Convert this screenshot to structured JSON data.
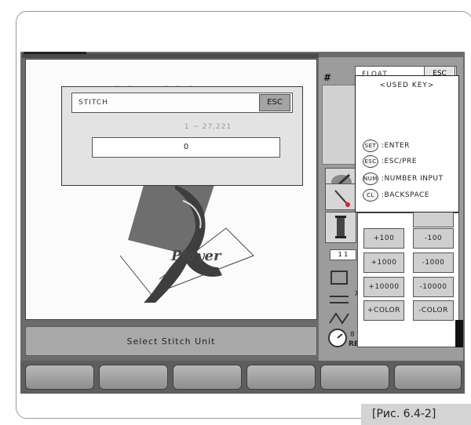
{
  "stitch_dialog": {
    "title": "STITCH",
    "esc_label": "ESC",
    "range": "1 ~ 27,221",
    "value": "0"
  },
  "float_dialog": {
    "title": "FLOAT",
    "esc_label": "ESC",
    "used_key": {
      "title": "<USED KEY>",
      "items": [
        {
          "key": "SET",
          "desc": ":ENTER"
        },
        {
          "key": "ESC",
          "desc": ":ESC/PRE"
        },
        {
          "key": "NUM",
          "desc": ":NUMBER INPUT"
        },
        {
          "key": "CL",
          "desc": ":BACKSPACE"
        }
      ]
    },
    "buttons": [
      "+100",
      "-100",
      "+1000",
      "-1000",
      "+10000",
      "-10000",
      "+COLOR",
      "-COLOR"
    ]
  },
  "side": {
    "hash": "#",
    "fragment_1": "8",
    "fragment_2": "RE",
    "fragment_3": "1  1",
    "x_label": "X"
  },
  "status_text": "Select Stitch Unit",
  "design_label": "Player",
  "caption": "[Рис. 6.4-2]"
}
